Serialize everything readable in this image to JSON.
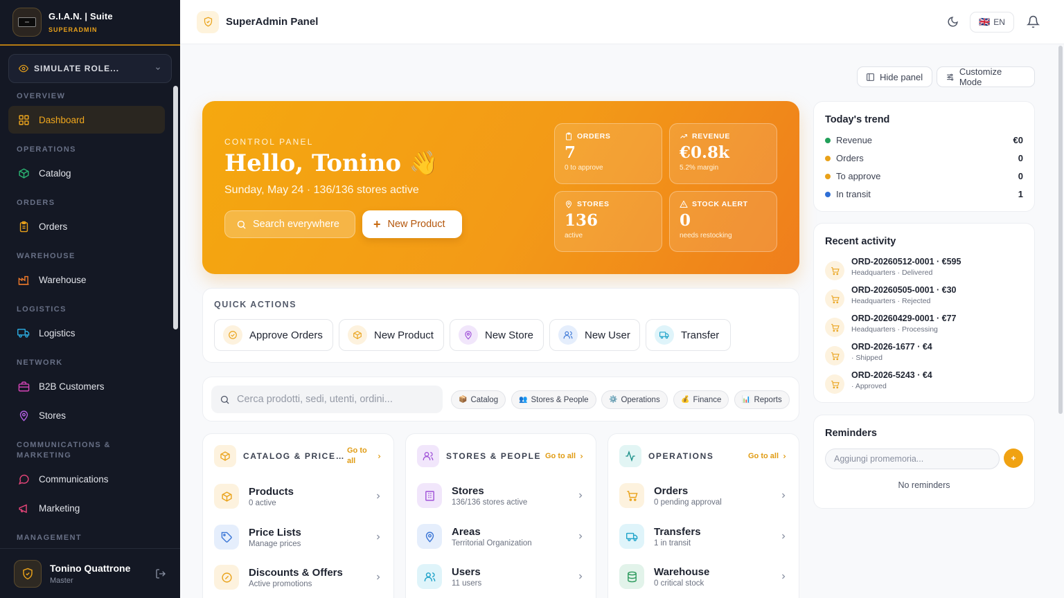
{
  "brand": {
    "name": "G.I.A.N. | Suite",
    "role": "SUPERADMIN"
  },
  "simulate": {
    "label": "SIMULATE ROLE..."
  },
  "nav": {
    "overview": "OVERVIEW",
    "dashboard": "Dashboard",
    "operations": "OPERATIONS",
    "catalog": "Catalog",
    "orders_sec": "ORDERS",
    "orders": "Orders",
    "warehouse_sec": "WAREHOUSE",
    "warehouse": "Warehouse",
    "logistics_sec": "LOGISTICS",
    "logistics": "Logistics",
    "network": "NETWORK",
    "b2b": "B2B Customers",
    "stores": "Stores",
    "comm_sec": "COMMUNICATIONS & MARKETING",
    "communications": "Communications",
    "marketing": "Marketing",
    "management": "MANAGEMENT"
  },
  "user": {
    "name": "Tonino Quattrone",
    "role": "Master"
  },
  "topbar": {
    "title": "SuperAdmin Panel",
    "lang_flag": "🇬🇧",
    "lang": "EN"
  },
  "toolbar": {
    "hide_panel": "Hide panel",
    "customize": "Customize Mode"
  },
  "hero": {
    "eyebrow": "CONTROL PANEL",
    "greeting": "Hello, Tonino 👋",
    "subtitle": "Sunday, May 24 · 136/136 stores active",
    "search": "Search everywhere",
    "new_product": "New Product",
    "stats": {
      "orders": {
        "label": "ORDERS",
        "value": "7",
        "sub": "0 to approve"
      },
      "revenue": {
        "label": "REVENUE",
        "value": "€0.8k",
        "sub": "5.2% margin"
      },
      "stores": {
        "label": "STORES",
        "value": "136",
        "sub": "active"
      },
      "stock": {
        "label": "STOCK ALERT",
        "value": "0",
        "sub": "needs restocking"
      }
    }
  },
  "quick_actions": {
    "title": "QUICK ACTIONS",
    "approve": "Approve Orders",
    "new_product": "New Product",
    "new_store": "New Store",
    "new_user": "New User",
    "transfer": "Transfer"
  },
  "search": {
    "placeholder": "Cerca prodotti, sedi, utenti, ordini...",
    "chips": {
      "catalog": "Catalog",
      "stores_people": "Stores & People",
      "operations": "Operations",
      "finance": "Finance",
      "reports": "Reports"
    },
    "chip_icons": {
      "catalog": "📦",
      "stores_people": "👥",
      "operations": "⚙️",
      "finance": "💰",
      "reports": "📊"
    }
  },
  "sections": {
    "catalog": {
      "title": "CATALOG & PRICE LISTS",
      "goall": "Go to all",
      "items": [
        {
          "title": "Products",
          "sub": "0 active"
        },
        {
          "title": "Price Lists",
          "sub": "Manage prices"
        },
        {
          "title": "Discounts & Offers",
          "sub": "Active promotions"
        }
      ]
    },
    "stores": {
      "title": "STORES & PEOPLE",
      "goall": "Go to all",
      "items": [
        {
          "title": "Stores",
          "sub": "136/136 stores active"
        },
        {
          "title": "Areas",
          "sub": "Territorial Organization"
        },
        {
          "title": "Users",
          "sub": "11 users"
        }
      ]
    },
    "operations": {
      "title": "OPERATIONS",
      "goall": "Go to all",
      "items": [
        {
          "title": "Orders",
          "sub": "0 pending approval"
        },
        {
          "title": "Transfers",
          "sub": "1 in transit"
        },
        {
          "title": "Warehouse",
          "sub": "0 critical stock"
        }
      ]
    }
  },
  "trend": {
    "title": "Today's trend",
    "rows": [
      {
        "label": "Revenue",
        "value": "€0",
        "color": "#22a05a"
      },
      {
        "label": "Orders",
        "value": "0",
        "color": "#e9a21a"
      },
      {
        "label": "To approve",
        "value": "0",
        "color": "#e9a21a"
      },
      {
        "label": "In transit",
        "value": "1",
        "color": "#2f6fd6"
      }
    ]
  },
  "activity": {
    "title": "Recent activity",
    "items": [
      {
        "title": "ORD-20260512-0001 · €595",
        "sub": "Headquarters · Delivered"
      },
      {
        "title": "ORD-20260505-0001 · €30",
        "sub": "Headquarters · Rejected"
      },
      {
        "title": "ORD-20260429-0001 · €77",
        "sub": "Headquarters · Processing"
      },
      {
        "title": "ORD-2026-1677 · €4",
        "sub": "· Shipped"
      },
      {
        "title": "ORD-2026-5243 · €4",
        "sub": "· Approved"
      }
    ]
  },
  "reminders": {
    "title": "Reminders",
    "placeholder": "Aggiungi promemoria...",
    "add": "+",
    "empty": "No reminders"
  },
  "colors": {
    "accent": "#f0a212",
    "sidebar_bg": "#141824",
    "hero_start": "#f5a80f",
    "hero_end": "#ef7e1c"
  }
}
